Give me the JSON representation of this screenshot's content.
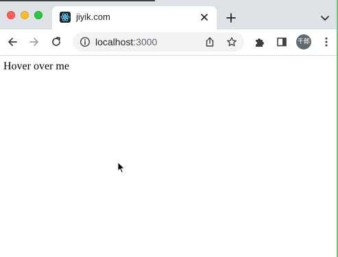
{
  "browser": {
    "tab": {
      "title": "jiyik.com",
      "favicon": "react-icon"
    },
    "address_bar": {
      "host": "localhost",
      "port": ":3000"
    },
    "profile_avatar_text": "千郎"
  },
  "page": {
    "text": "Hover over me"
  },
  "colors": {
    "tabstrip_bg": "#dee1e6",
    "omnibox_bg": "#f1f3f4",
    "accent_edge": "#4cd964"
  }
}
